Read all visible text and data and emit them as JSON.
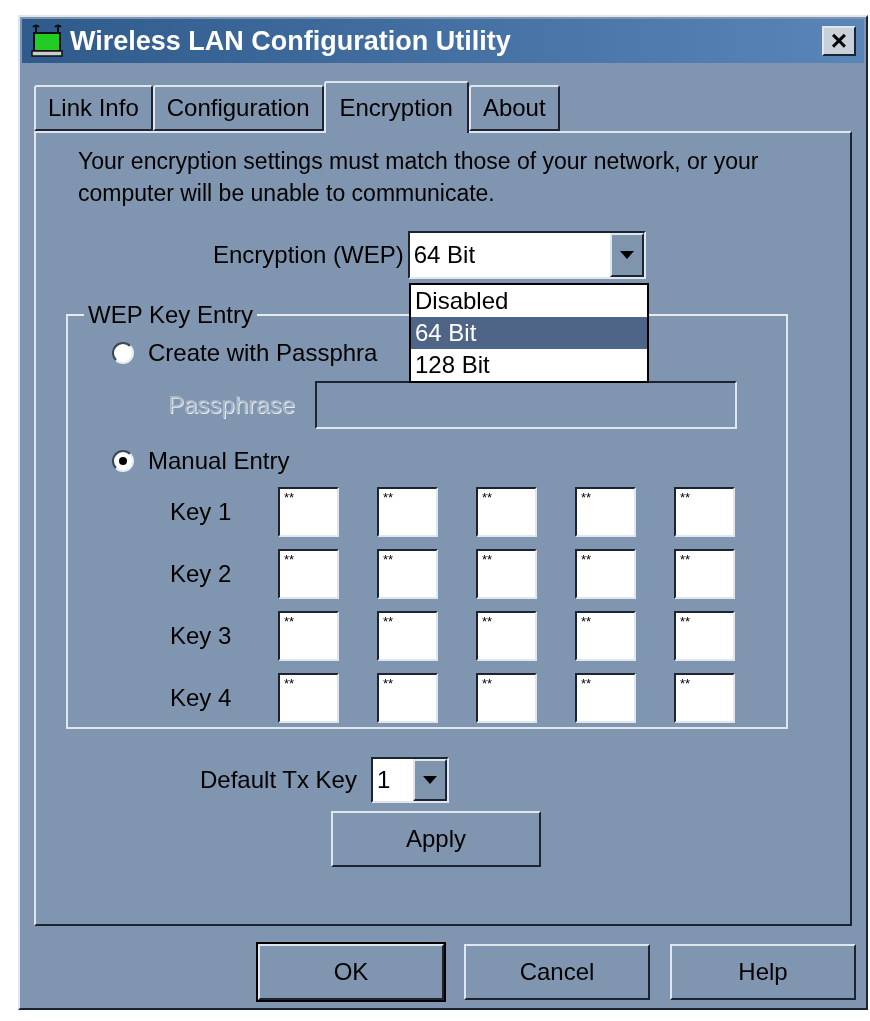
{
  "window": {
    "title": "Wireless LAN Configuration Utility",
    "close": "×"
  },
  "tabs": [
    {
      "label": "Link Info",
      "selected": false
    },
    {
      "label": "Configuration",
      "selected": false
    },
    {
      "label": "Encryption",
      "selected": true
    },
    {
      "label": "About",
      "selected": false
    }
  ],
  "intro": "Your encryption settings must match those of your network, or your computer will be unable to communicate.",
  "encryption": {
    "label": "Encryption (WEP)",
    "value": "64 Bit",
    "expanded": true,
    "options": [
      {
        "label": "Disabled",
        "selected": false
      },
      {
        "label": "64 Bit",
        "selected": true
      },
      {
        "label": "128 Bit",
        "selected": false
      }
    ]
  },
  "wep_key_entry": {
    "title": "WEP Key Entry",
    "modes": [
      {
        "label": "Create with Passphra",
        "selected": false
      },
      {
        "label": "Manual Entry",
        "selected": true
      }
    ],
    "passphrase": {
      "label": "Passphrase",
      "disabled": true
    },
    "keys": [
      {
        "label": "Key 1",
        "fields": [
          "**",
          "**",
          "**",
          "**",
          "**"
        ]
      },
      {
        "label": "Key 2",
        "fields": [
          "**",
          "**",
          "**",
          "**",
          "**"
        ]
      },
      {
        "label": "Key 3",
        "fields": [
          "**",
          "**",
          "**",
          "**",
          "**"
        ]
      },
      {
        "label": "Key 4",
        "fields": [
          "**",
          "**",
          "**",
          "**",
          "**"
        ]
      }
    ]
  },
  "default_tx_key": {
    "label": "Default Tx Key",
    "value": "1"
  },
  "apply": "Apply",
  "buttons": [
    "OK",
    "Cancel",
    "Help"
  ]
}
